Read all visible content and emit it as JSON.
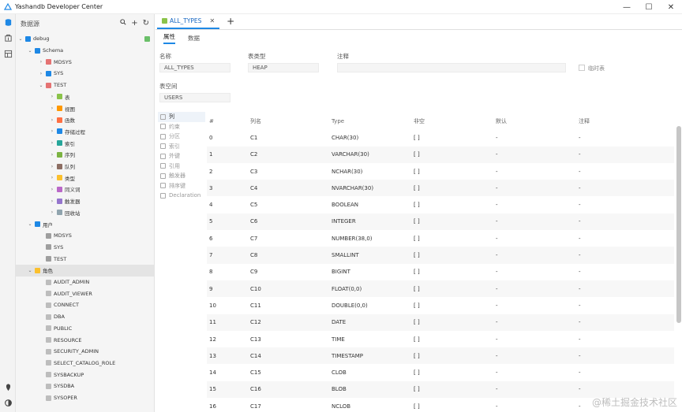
{
  "window": {
    "title": "Yashandb Developer Center",
    "minimize_glyph": "—",
    "maximize_glyph": "☐",
    "close_glyph": "✕"
  },
  "activity_bar": {
    "icons": [
      "database-icon",
      "cylinder-icon",
      "grid-icon"
    ],
    "bottom_icons": [
      "location-pin-icon",
      "theme-toggle-icon"
    ]
  },
  "sidebar": {
    "title": "数据源",
    "tools": {
      "search": "🔍",
      "add": "+",
      "refresh": "↻"
    },
    "tree": [
      {
        "label": "debug",
        "level": 0,
        "expanded": true,
        "icon": "connection-icon",
        "color": "#1e88e5",
        "lock": true
      },
      {
        "label": "Schema",
        "level": 1,
        "expanded": true,
        "icon": "schema-icon",
        "color": "#1e88e5"
      },
      {
        "label": "MDSYS",
        "level": 2,
        "expanded": false,
        "icon": "schema-icon",
        "color": "#e57373"
      },
      {
        "label": "SYS",
        "level": 2,
        "expanded": false,
        "icon": "schema-icon",
        "color": "#1e88e5"
      },
      {
        "label": "TEST",
        "level": 2,
        "expanded": true,
        "icon": "schema-icon",
        "color": "#e57373"
      },
      {
        "label": "表",
        "level": 3,
        "expanded": false,
        "icon": "table-icon",
        "color": "#8bc34a"
      },
      {
        "label": "视图",
        "level": 3,
        "expanded": false,
        "icon": "view-icon",
        "color": "#ff9800"
      },
      {
        "label": "函数",
        "level": 3,
        "expanded": false,
        "icon": "function-icon",
        "color": "#ff7043"
      },
      {
        "label": "存储过程",
        "level": 3,
        "expanded": false,
        "icon": "procedure-icon",
        "color": "#1e88e5"
      },
      {
        "label": "索引",
        "level": 3,
        "expanded": false,
        "icon": "index-icon",
        "color": "#26a69a"
      },
      {
        "label": "序列",
        "level": 3,
        "expanded": false,
        "icon": "sequence-icon",
        "color": "#7cb342"
      },
      {
        "label": "队列",
        "level": 3,
        "expanded": false,
        "icon": "queue-icon",
        "color": "#8d6e63"
      },
      {
        "label": "类型",
        "level": 3,
        "expanded": false,
        "icon": "type-icon",
        "color": "#fbc02d"
      },
      {
        "label": "同义词",
        "level": 3,
        "expanded": false,
        "icon": "synonym-icon",
        "color": "#ba68c8"
      },
      {
        "label": "触发器",
        "level": 3,
        "expanded": false,
        "icon": "trigger-icon",
        "color": "#9575cd"
      },
      {
        "label": "回收站",
        "level": 3,
        "expanded": false,
        "icon": "recycle-icon",
        "color": "#90a4ae"
      },
      {
        "label": "用户",
        "level": 1,
        "expanded": true,
        "icon": "user-icon",
        "color": "#1e88e5"
      },
      {
        "label": "MDSYS",
        "level": 2,
        "leaf": true,
        "icon": "user-icon",
        "color": "#9e9e9e"
      },
      {
        "label": "SYS",
        "level": 2,
        "leaf": true,
        "icon": "user-icon",
        "color": "#9e9e9e"
      },
      {
        "label": "TEST",
        "level": 2,
        "leaf": true,
        "icon": "user-icon",
        "color": "#9e9e9e"
      },
      {
        "label": "角色",
        "level": 1,
        "expanded": true,
        "icon": "role-icon",
        "color": "#fbc02d",
        "selected": true
      },
      {
        "label": "AUDIT_ADMIN",
        "level": 2,
        "leaf": true,
        "icon": "role-icon",
        "color": "#bdbdbd"
      },
      {
        "label": "AUDIT_VIEWER",
        "level": 2,
        "leaf": true,
        "icon": "role-icon",
        "color": "#bdbdbd"
      },
      {
        "label": "CONNECT",
        "level": 2,
        "leaf": true,
        "icon": "role-icon",
        "color": "#bdbdbd"
      },
      {
        "label": "DBA",
        "level": 2,
        "leaf": true,
        "icon": "role-icon",
        "color": "#bdbdbd"
      },
      {
        "label": "PUBLIC",
        "level": 2,
        "leaf": true,
        "icon": "role-icon",
        "color": "#bdbdbd"
      },
      {
        "label": "RESOURCE",
        "level": 2,
        "leaf": true,
        "icon": "role-icon",
        "color": "#bdbdbd"
      },
      {
        "label": "SECURITY_ADMIN",
        "level": 2,
        "leaf": true,
        "icon": "role-icon",
        "color": "#bdbdbd"
      },
      {
        "label": "SELECT_CATALOG_ROLE",
        "level": 2,
        "leaf": true,
        "icon": "role-icon",
        "color": "#bdbdbd"
      },
      {
        "label": "SYSBACKUP",
        "level": 2,
        "leaf": true,
        "icon": "role-icon",
        "color": "#bdbdbd"
      },
      {
        "label": "SYSDBA",
        "level": 2,
        "leaf": true,
        "icon": "role-icon",
        "color": "#bdbdbd"
      },
      {
        "label": "SYSOPER",
        "level": 2,
        "leaf": true,
        "icon": "role-icon",
        "color": "#bdbdbd"
      }
    ]
  },
  "editor": {
    "tab": {
      "label": "ALL_TYPES",
      "close": "✕"
    },
    "add_tab": "+",
    "subtabs": [
      {
        "label": "属性",
        "active": true
      },
      {
        "label": "数据",
        "active": false
      }
    ],
    "fields": {
      "name_label": "名称",
      "name_value": "ALL_TYPES",
      "type_label": "表类型",
      "type_value": "HEAP",
      "comment_label": "注释",
      "comment_value": "",
      "temp_label": "临时表",
      "tablespace_label": "表空间",
      "tablespace_value": "USERS"
    },
    "prop_nav": [
      {
        "label": "列",
        "icon": "columns-icon",
        "active": true
      },
      {
        "label": "约束",
        "icon": "constraint-icon"
      },
      {
        "label": "分区",
        "icon": "partition-icon"
      },
      {
        "label": "索引",
        "icon": "index-icon"
      },
      {
        "label": "外键",
        "icon": "foreign-key-icon"
      },
      {
        "label": "引用",
        "icon": "reference-icon"
      },
      {
        "label": "触发器",
        "icon": "trigger-icon"
      },
      {
        "label": "排序键",
        "icon": "sort-key-icon"
      },
      {
        "label": "Declaration",
        "icon": "declaration-icon"
      }
    ],
    "columns_header": [
      "#",
      "列名",
      "Type",
      "非空",
      "默认",
      "注释"
    ],
    "columns": [
      [
        "0",
        "C1",
        "CHAR(30)",
        "[ ]",
        "-",
        "-"
      ],
      [
        "1",
        "C2",
        "VARCHAR(30)",
        "[ ]",
        "-",
        "-"
      ],
      [
        "2",
        "C3",
        "NCHAR(30)",
        "[ ]",
        "-",
        "-"
      ],
      [
        "3",
        "C4",
        "NVARCHAR(30)",
        "[ ]",
        "-",
        "-"
      ],
      [
        "4",
        "C5",
        "BOOLEAN",
        "[ ]",
        "-",
        "-"
      ],
      [
        "5",
        "C6",
        "INTEGER",
        "[ ]",
        "-",
        "-"
      ],
      [
        "6",
        "C7",
        "NUMBER(38,0)",
        "[ ]",
        "-",
        "-"
      ],
      [
        "7",
        "C8",
        "SMALLINT",
        "[ ]",
        "-",
        "-"
      ],
      [
        "8",
        "C9",
        "BIGINT",
        "[ ]",
        "-",
        "-"
      ],
      [
        "9",
        "C10",
        "FLOAT(0,0)",
        "[ ]",
        "-",
        "-"
      ],
      [
        "10",
        "C11",
        "DOUBLE(0,0)",
        "[ ]",
        "-",
        "-"
      ],
      [
        "11",
        "C12",
        "DATE",
        "[ ]",
        "-",
        "-"
      ],
      [
        "12",
        "C13",
        "TIME",
        "[ ]",
        "-",
        "-"
      ],
      [
        "13",
        "C14",
        "TIMESTAMP",
        "[ ]",
        "-",
        "-"
      ],
      [
        "14",
        "C15",
        "CLOB",
        "[ ]",
        "-",
        "-"
      ],
      [
        "15",
        "C16",
        "BLOB",
        "[ ]",
        "-",
        "-"
      ],
      [
        "16",
        "C17",
        "NCLOB",
        "[ ]",
        "-",
        "-"
      ]
    ]
  },
  "watermark": "@稀土掘金技术社区",
  "colors": {
    "accent": "#1e88e5",
    "selection": "#e4e4e4",
    "alt_row": "#f7f7f7"
  }
}
